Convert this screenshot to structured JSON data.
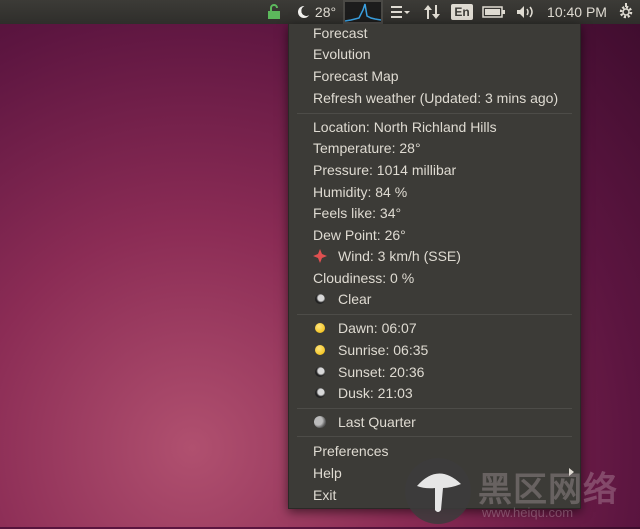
{
  "topbar": {
    "temperature": "28°",
    "keyboard_layout": "En",
    "clock": "10:40 PM",
    "icons": [
      "lock-icon",
      "moon-icon",
      "system-monitor-graph-icon",
      "menu-list-icon",
      "transfer-arrows-icon",
      "battery-icon",
      "volume-icon",
      "gear-icon"
    ]
  },
  "menu": {
    "forecast": "Forecast",
    "evolution": "Evolution",
    "forecast_map": "Forecast Map",
    "refresh": "Refresh weather (Updated: 3 mins ago)",
    "location": "Location: North Richland Hills",
    "temperature": "Temperature: 28°",
    "pressure": "Pressure: 1014 millibar",
    "humidity": "Humidity: 84 %",
    "feels_like": "Feels like: 34°",
    "dew_point": "Dew Point: 26°",
    "wind": "Wind: 3 km/h (SSE)",
    "cloudiness": "Cloudiness: 0 %",
    "condition": "Clear",
    "dawn": "Dawn: 06:07",
    "sunrise": "Sunrise: 06:35",
    "sunset": "Sunset: 20:36",
    "dusk": "Dusk: 21:03",
    "moon_phase": "Last Quarter",
    "preferences": "Preferences",
    "help": "Help",
    "exit": "Exit"
  },
  "watermark": {
    "text": "黑区网络",
    "sub": "www.heiqu.com"
  }
}
